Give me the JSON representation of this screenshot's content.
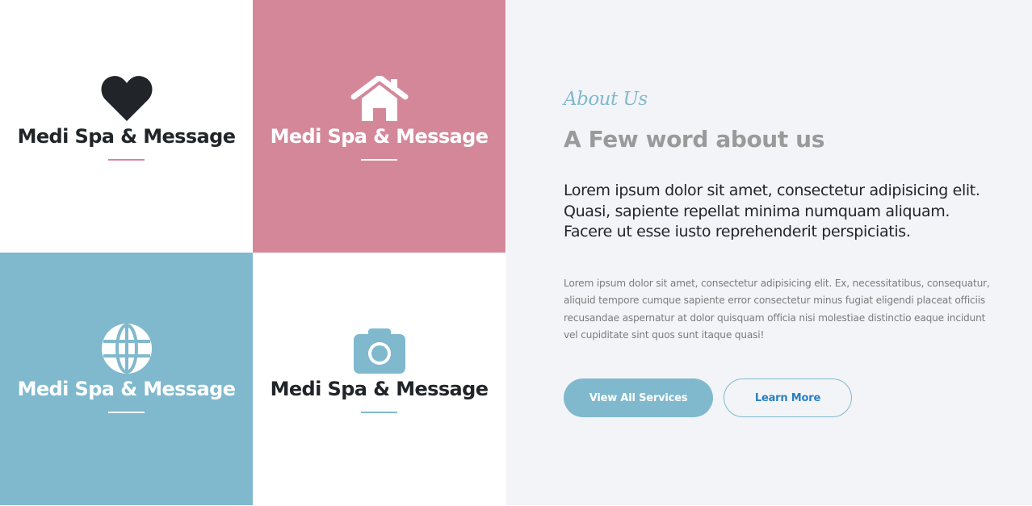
{
  "tiles": [
    {
      "icon": "heart-icon",
      "title": "Medi Spa & Message"
    },
    {
      "icon": "home-icon",
      "title": "Medi Spa & Message"
    },
    {
      "icon": "globe-icon",
      "title": "Medi Spa & Message"
    },
    {
      "icon": "camera-icon",
      "title": "Medi Spa & Message"
    }
  ],
  "about": {
    "kicker": "About Us",
    "heading": "A Few word about us",
    "lead": "Lorem ipsum dolor sit amet, consectetur adipisicing elit. Quasi, sapiente repellat minima numquam aliquam. Facere ut esse iusto reprehenderit perspiciatis.",
    "body": "Lorem ipsum dolor sit amet, consectetur adipisicing elit. Ex, necessitatibus, consequatur, aliquid tempore cumque sapiente error consectetur minus fugiat eligendi placeat officiis recusandae aspernatur at dolor quisquam officia nisi molestiae distinctio eaque incidunt vel cupiditate sint quos sunt itaque quasi!"
  },
  "buttons": {
    "primary_label": "View All Services",
    "secondary_label": "Learn More"
  },
  "colors": {
    "pink": "#d5879a",
    "blue": "#80b9cd",
    "dark": "#212529",
    "panel_bg": "#f3f4f8"
  }
}
